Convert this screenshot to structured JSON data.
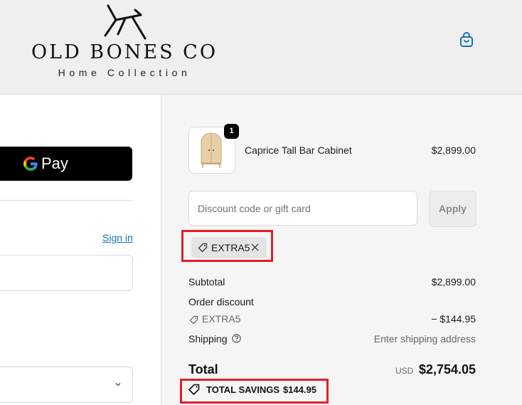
{
  "brand": {
    "name": "OLD BONES CO",
    "tagline": "Home Collection"
  },
  "icons": {
    "logo": "chair-logo-icon",
    "cart": "shopping-bag-icon",
    "google": "google-g-icon",
    "discount_tag": "tag-icon",
    "remove": "close-icon",
    "help": "question-circle-icon",
    "select": "chevron-down-icon"
  },
  "express": {
    "gpay_label": "Pay"
  },
  "contact": {
    "sign_in": "Sign in"
  },
  "order": {
    "items": [
      {
        "name": "Caprice Tall Bar Cabinet",
        "quantity": "1",
        "price": "$2,899.00"
      }
    ],
    "discount": {
      "placeholder": "Discount code or gift card",
      "apply_label": "Apply",
      "applied_code": "EXTRA5"
    },
    "summary": {
      "subtotal_label": "Subtotal",
      "subtotal_value": "$2,899.00",
      "order_discount_label": "Order discount",
      "discount_code": "EXTRA5",
      "discount_value": "− $144.95",
      "shipping_label": "Shipping",
      "shipping_value": "Enter shipping address",
      "total_label": "Total",
      "currency": "USD",
      "total_value": "$2,754.05",
      "savings_label": "TOTAL SAVINGS",
      "savings_value": "$144.95"
    }
  },
  "colors": {
    "header_bg": "#efefef",
    "summary_bg": "#f5f5f5",
    "link": "#1773b0",
    "highlight": "#e0202a"
  }
}
